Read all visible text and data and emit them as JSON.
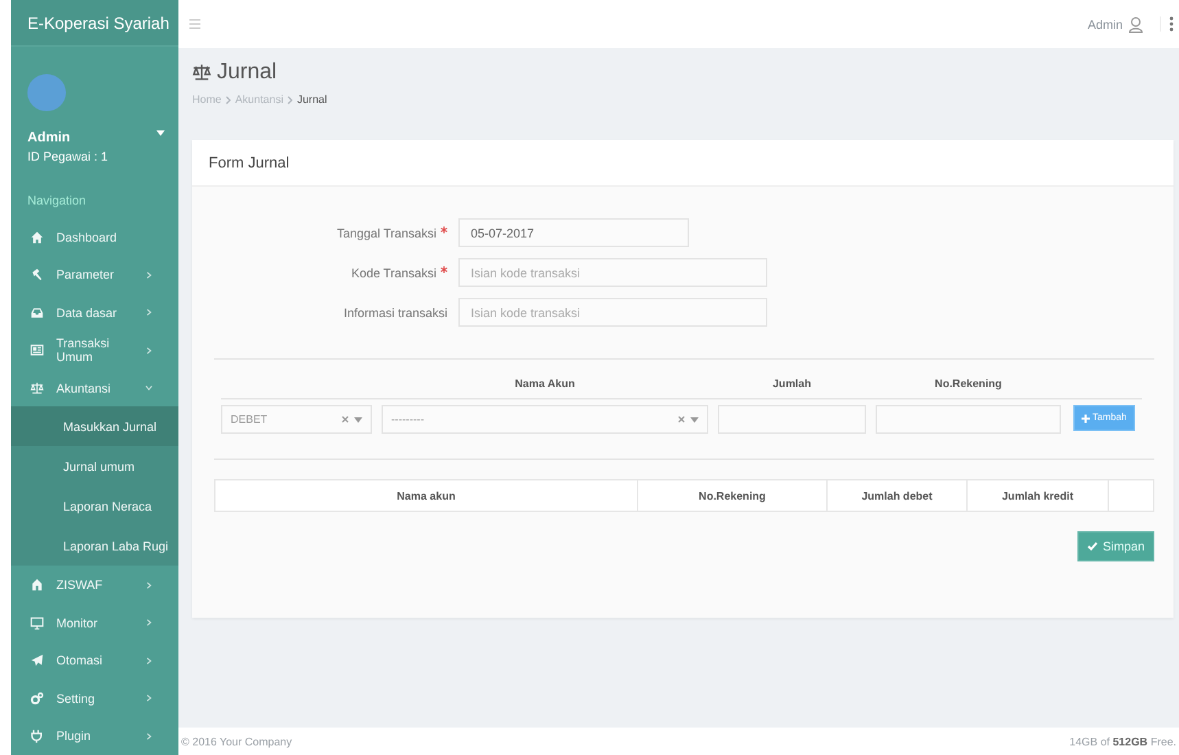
{
  "app": {
    "title": "E-Koperasi Syariah"
  },
  "user": {
    "name": "Admin",
    "id": "ID Pegawai : 1"
  },
  "sidebar": {
    "heading": "Navigation",
    "items": [
      {
        "label": "Dashboard",
        "has_arrow": false,
        "expanded": false
      },
      {
        "label": "Parameter",
        "has_arrow": true,
        "expanded": false
      },
      {
        "label": "Data dasar",
        "has_arrow": true,
        "expanded": false
      },
      {
        "label": "Transaksi Umum",
        "has_arrow": true,
        "expanded": false
      },
      {
        "label": "Akuntansi",
        "has_arrow": true,
        "expanded": true,
        "children": [
          {
            "label": "Masukkan Jurnal",
            "selected": true
          },
          {
            "label": "Jurnal umum",
            "selected": false
          },
          {
            "label": "Laporan Neraca",
            "selected": false
          },
          {
            "label": "Laporan Laba Rugi",
            "selected": false
          }
        ]
      },
      {
        "label": "ZISWAF",
        "has_arrow": true,
        "expanded": false
      },
      {
        "label": "Monitor",
        "has_arrow": true,
        "expanded": false
      },
      {
        "label": "Otomasi",
        "has_arrow": true,
        "expanded": false
      },
      {
        "label": "Setting",
        "has_arrow": true,
        "expanded": false
      },
      {
        "label": "Plugin",
        "has_arrow": true,
        "expanded": false
      }
    ]
  },
  "topbar": {
    "user": "Admin"
  },
  "page": {
    "title": "Jurnal",
    "breadcrumb": [
      "Home",
      "Akuntansi",
      "Jurnal"
    ]
  },
  "form": {
    "title": "Form Jurnal",
    "fields": [
      {
        "label": "Tanggal Transaksi",
        "required": true,
        "value": "05-07-2017",
        "kind": "date"
      },
      {
        "label": "Kode Transaksi",
        "required": true,
        "placeholder": "Isian kode transaksi",
        "kind": "text"
      },
      {
        "label": "Informasi transaksi",
        "required": false,
        "placeholder": "Isian kode transaksi",
        "kind": "text"
      }
    ],
    "entry_columns": [
      "Nama Akun",
      "Jumlah",
      "No.Rekening"
    ],
    "entry": {
      "type": "DEBET",
      "account": "---------",
      "add_button": "Tambah"
    },
    "table": {
      "columns": [
        "Nama akun",
        "No.Rekening",
        "Jumlah debet",
        "Jumlah kredit"
      ]
    },
    "save_button": "Simpan"
  },
  "footer": {
    "left": "© 2016 Your Company",
    "right": "14GB of **512GB** Free."
  }
}
